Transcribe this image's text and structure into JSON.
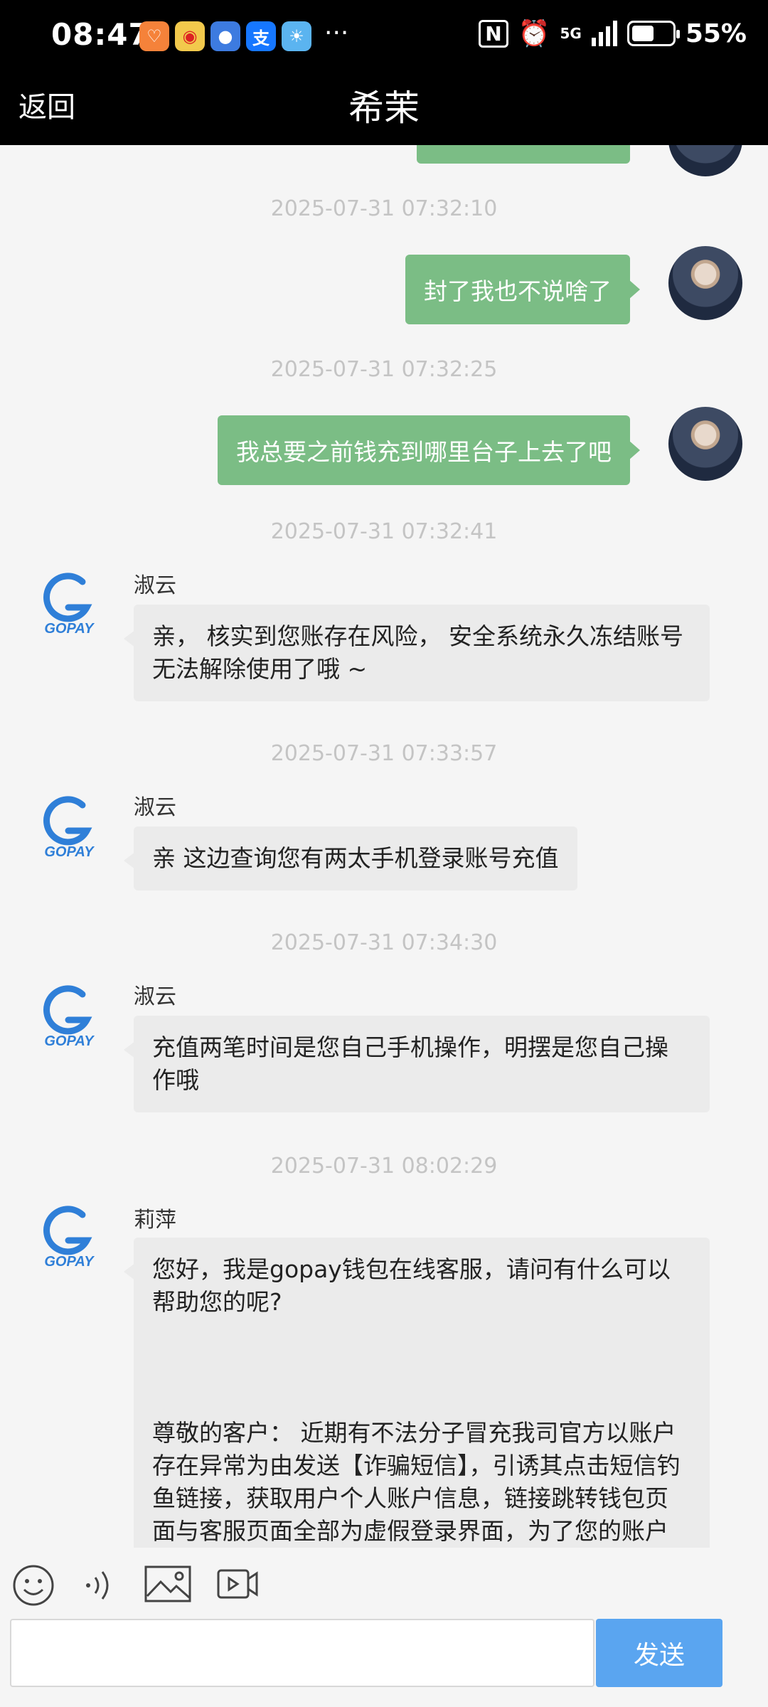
{
  "status_bar": {
    "time": "08:47",
    "network": "5G",
    "battery": "55%",
    "battery_level": 0.55,
    "more": "···",
    "app_icons": [
      {
        "name": "taobao-app-icon",
        "color": "#f5823a"
      },
      {
        "name": "weibo-app-icon",
        "color": "#f2c94c"
      },
      {
        "name": "browser-app-icon",
        "color": "#3d7be0"
      },
      {
        "name": "alipay-app-icon",
        "color": "#1677ff",
        "glyph": "支"
      },
      {
        "name": "weather-app-icon",
        "color": "#5bb4f0"
      }
    ]
  },
  "header": {
    "back_label": "返回",
    "title": "希茉"
  },
  "brand": {
    "logo_text": "GOPAY",
    "logo_color": "#2f7fd8",
    "outgoing_bubble_color": "#7bbd85",
    "incoming_bubble_color": "#ebebeb",
    "send_button_color": "#5aa5f0"
  },
  "chat": {
    "timestamps": [
      "2025-07-31 07:32:10",
      "2025-07-31 07:32:25",
      "2025-07-31 07:32:41",
      "2025-07-31 07:33:57",
      "2025-07-31 07:34:30",
      "2025-07-31 08:02:29"
    ],
    "outgoing": [
      "封了我也不说啥了",
      "我总要之前钱充到哪里台子上去了吧"
    ],
    "incoming": [
      {
        "sender": "淑云",
        "paragraphs": [
          "亲， 核实到您账存在风险， 安全系统永久冻结账号 无法解除使用了哦 ~"
        ]
      },
      {
        "sender": "淑云",
        "paragraphs": [
          "亲 这边查询您有两太手机登录账号充值"
        ]
      },
      {
        "sender": "淑云",
        "paragraphs": [
          "充值两笔时间是您自己手机操作，明摆是您自己操作哦"
        ]
      },
      {
        "sender": "莉萍",
        "paragraphs": [
          "您好，我是gopay钱包在线客服，请问有什么可以帮助您的呢?",
          "尊敬的客户： 近期有不法分子冒充我司官方以账户存在异常为由发送【诈骗短信】，引诱其点击短信钓鱼链接，获取用户个人账户信息，链接跳转钱包页面与客服页面全部为虚假登录界面，为了您的账户资金安全，请您不要理会！"
        ]
      }
    ]
  },
  "composer": {
    "input_value": "",
    "send_label": "发送",
    "tools": [
      "emoji-icon",
      "voice-icon",
      "image-icon",
      "video-icon"
    ]
  }
}
